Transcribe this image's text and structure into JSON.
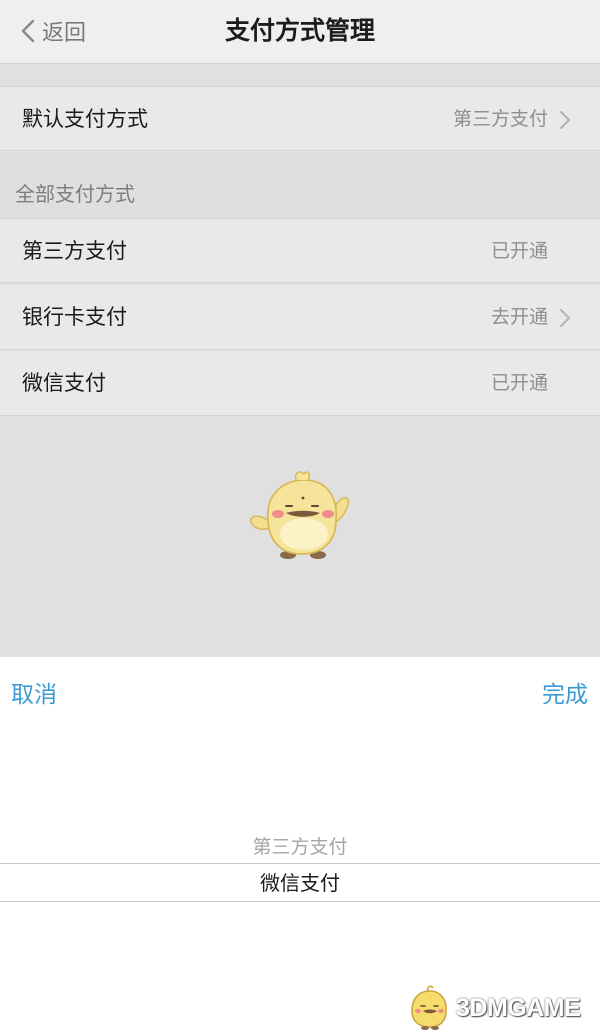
{
  "nav": {
    "back_label": "返回",
    "title": "支付方式管理"
  },
  "default_row": {
    "label": "默认支付方式",
    "value": "第三方支付"
  },
  "section": {
    "title": "全部支付方式"
  },
  "methods": [
    {
      "label": "第三方支付",
      "status": "已开通"
    },
    {
      "label": "银行卡支付",
      "status": "去开通"
    },
    {
      "label": "微信支付",
      "status": "已开通"
    }
  ],
  "picker": {
    "cancel_label": "取消",
    "done_label": "完成",
    "options": [
      "第三方支付",
      "微信支付"
    ],
    "selected": "微信支付"
  },
  "watermark": {
    "text": "3DMGAME"
  },
  "colors": {
    "accent": "#3c9ad6",
    "row_background": "#e9e9e9",
    "secondary_text": "#8e8e8e"
  },
  "icons": {
    "back": "chevron-left-icon",
    "disclosure": "chevron-right-icon",
    "mascot": "yellow-chick-mascot"
  }
}
